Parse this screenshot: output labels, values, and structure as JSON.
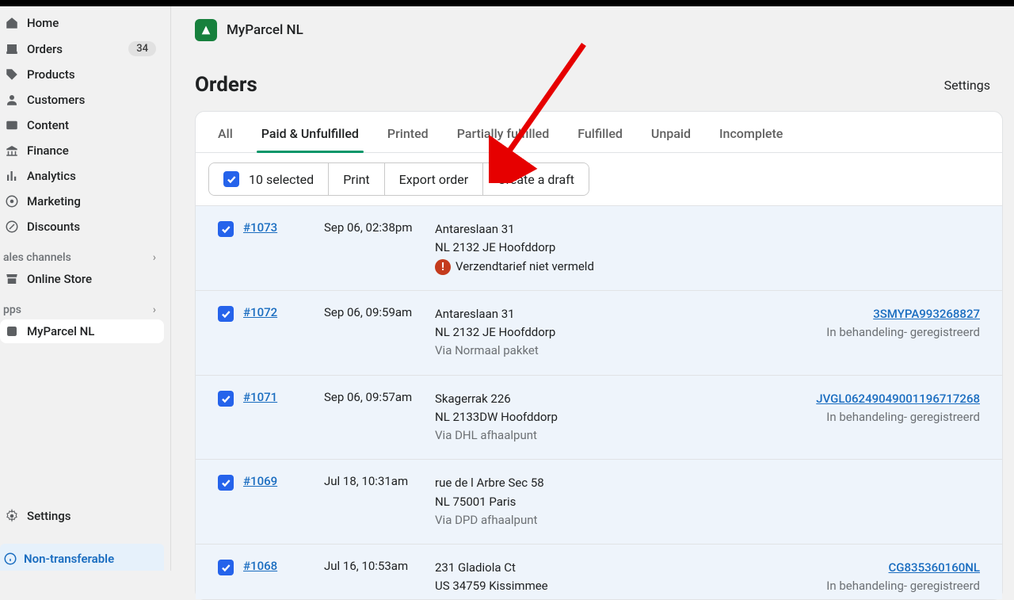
{
  "sidebar": {
    "items": [
      {
        "label": "Home"
      },
      {
        "label": "Orders",
        "badge": "34"
      },
      {
        "label": "Products"
      },
      {
        "label": "Customers"
      },
      {
        "label": "Content"
      },
      {
        "label": "Finance"
      },
      {
        "label": "Analytics"
      },
      {
        "label": "Marketing"
      },
      {
        "label": "Discounts"
      }
    ],
    "sales_channels_label": "ales channels",
    "online_store_label": "Online Store",
    "apps_label": "pps",
    "app_item_label": "MyParcel NL",
    "settings_label": "Settings",
    "non_transferable_label": "Non-transferable"
  },
  "app_header": {
    "title": "MyParcel NL"
  },
  "page": {
    "title": "Orders",
    "settings_label": "Settings"
  },
  "tabs": [
    "All",
    "Paid & Unfulfilled",
    "Printed",
    "Partially fulfilled",
    "Fulfilled",
    "Unpaid",
    "Incomplete"
  ],
  "active_tab_index": 1,
  "actions": {
    "selected_label": "10 selected",
    "print_label": "Print",
    "export_label": "Export order",
    "create_draft_label": "Create a draft"
  },
  "orders": [
    {
      "id": "#1073",
      "date": "Sep 06, 02:38pm",
      "addr1": "Antareslaan 31",
      "addr2": "NL 2132 JE Hoofddorp",
      "warning": "Verzendtarief niet vermeld"
    },
    {
      "id": "#1072",
      "date": "Sep 06, 09:59am",
      "addr1": "Antareslaan 31",
      "addr2": "NL 2132 JE Hoofddorp",
      "via": "Via Normaal pakket",
      "tracking": "3SMYPA993268827",
      "status": "In behandeling- geregistreerd"
    },
    {
      "id": "#1071",
      "date": "Sep 06, 09:57am",
      "addr1": "Skagerrak 226",
      "addr2": "NL 2133DW Hoofddorp",
      "via": "Via DHL afhaalpunt",
      "tracking": "JVGL06249049001196717268",
      "status": "In behandeling- geregistreerd"
    },
    {
      "id": "#1069",
      "date": "Jul 18, 10:31am",
      "addr1": "rue de l Arbre Sec 58",
      "addr2": "NL 75001 Paris",
      "via": "Via DPD afhaalpunt"
    },
    {
      "id": "#1068",
      "date": "Jul 16, 10:53am",
      "addr1": "231 Gladiola Ct",
      "addr2": "US 34759 Kissimmee",
      "tracking": "CG835360160NL",
      "status": "In behandeling- geregistreerd"
    }
  ]
}
